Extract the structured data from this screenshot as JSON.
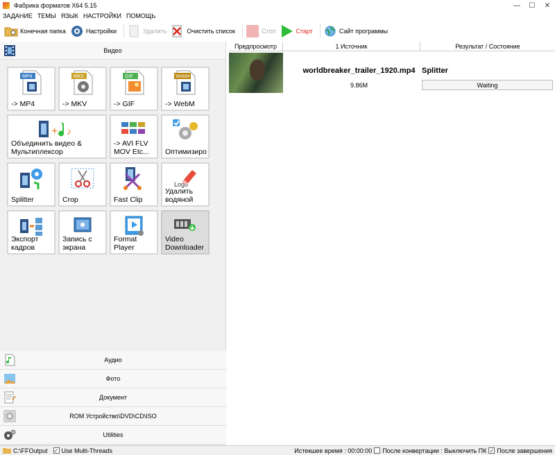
{
  "window": {
    "title": "Фабрика форматов X64 5.15"
  },
  "menu": [
    "ЗАДАНИЕ",
    "ТЕМЫ",
    "ЯЗЫК",
    "НАСТРОЙКИ",
    "ПОМОЩЬ"
  ],
  "toolbar": {
    "output_folder": "Конечная папка",
    "settings": "Настройки",
    "delete": "Удалить",
    "clear_list": "Очистить список",
    "stop": "Стоп",
    "start": "Старт",
    "website": "Сайт программы"
  },
  "categories": {
    "video": "Видео",
    "audio": "Аудио",
    "photo": "Фото",
    "document": "Документ",
    "rom": "ROM Устройство\\DVD\\CD\\ISO",
    "utilities": "Utilities"
  },
  "tiles": [
    "-> MP4",
    "-> MKV",
    "-> GIF",
    "-> WebM",
    "Объединить видео & Мультиплексор",
    "-> AVI FLV MOV Etc...",
    "Оптимизиро",
    "Splitter",
    "Crop",
    "Fast Clip",
    "Удалить водяной",
    "Экспорт кадров",
    "Запись с экрана",
    "Format Player",
    "Video Downloader"
  ],
  "tile_badges": {
    "mp4": "MP4",
    "mkv": "MKV",
    "gif": "GIF",
    "webm": "WebM",
    "logo": "Logo"
  },
  "table": {
    "headers": {
      "preview": "Предпросмотр",
      "source": "1 Источник",
      "result": "Результат / Состояние"
    },
    "rows": [
      {
        "filename": "worldbreaker_trailer_1920.mp4",
        "size": "9.86M",
        "result": "Splitter",
        "status": "Waiting"
      }
    ]
  },
  "statusbar": {
    "output_path": "C:\\FFOutput",
    "multithreads": "Use Multi-Threads",
    "elapsed": "Истекшее время : 00:00:00",
    "after_convert": "После конвертации : Выключить ПК",
    "after_finish": "После завершения"
  }
}
